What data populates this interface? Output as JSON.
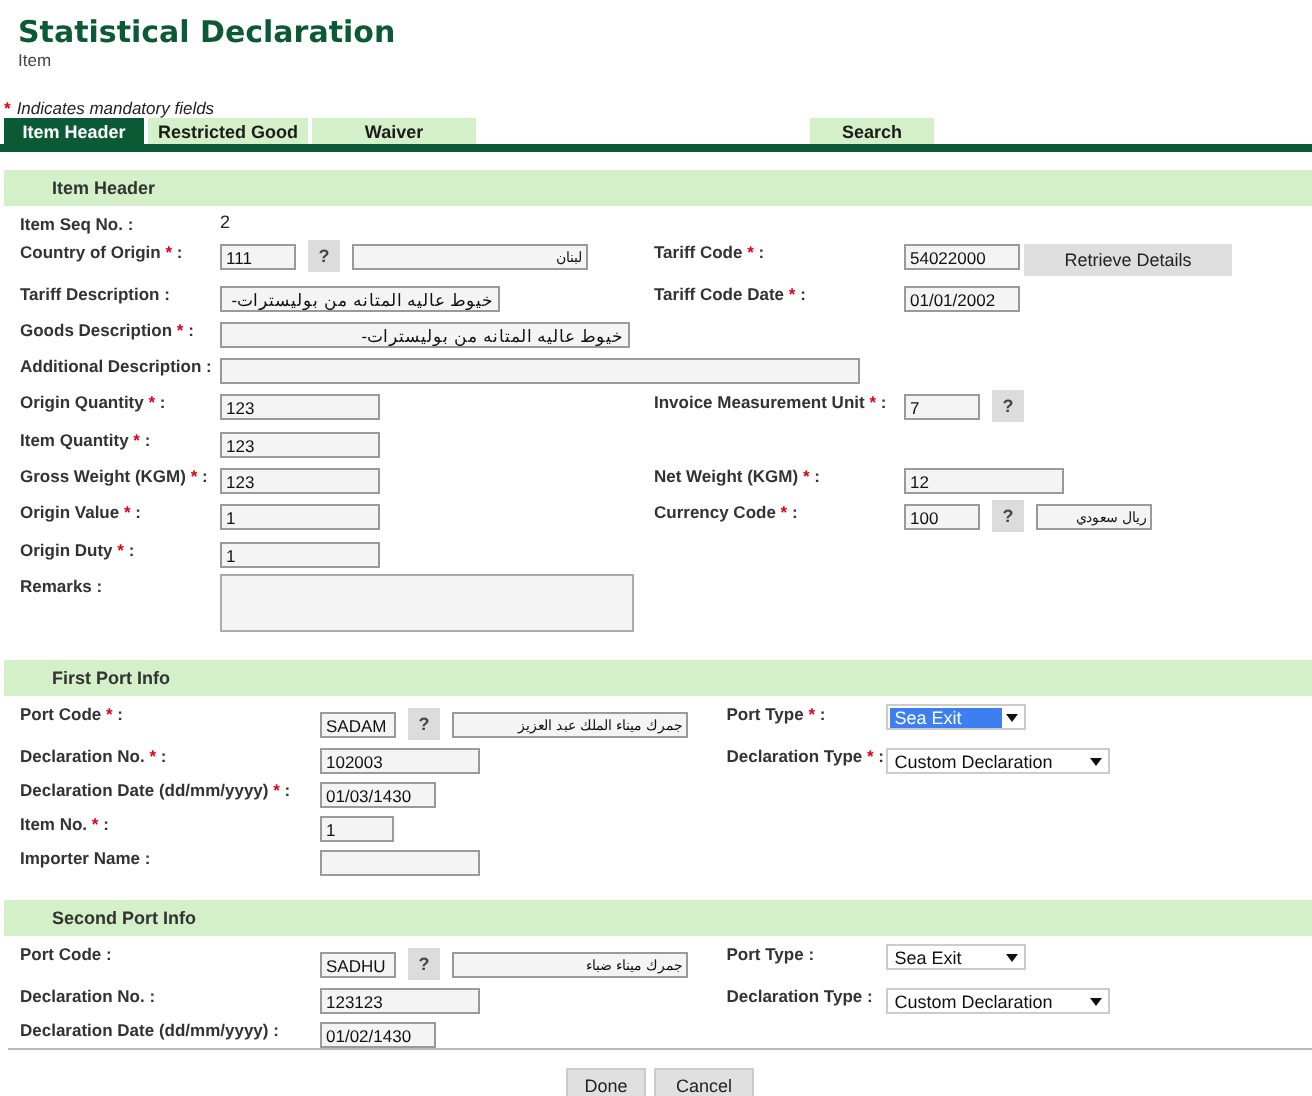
{
  "page": {
    "title": "Statistical Declaration",
    "subtitle": "Item"
  },
  "mandatory_note": {
    "mark": "*",
    "text": "Indicates mandatory fields"
  },
  "tabs": [
    {
      "label": "Item Header",
      "selected": true,
      "kind": "left"
    },
    {
      "label": "Restricted Good",
      "selected": false,
      "kind": "left"
    },
    {
      "label": "Waiver",
      "selected": false,
      "kind": "left"
    },
    {
      "label": "Search",
      "selected": false,
      "kind": "right"
    }
  ],
  "sections": [
    {
      "title": "Item Header",
      "kind": "item",
      "rows": [
        {
          "left": {
            "label": "Item Seq No.",
            "required": false,
            "suffix": ":",
            "controls": [
              {
                "kind": "value",
                "value": "2"
              }
            ]
          }
        },
        {
          "left": {
            "label": "Country of Origin",
            "required": true,
            "suffix": ":",
            "controls": [
              {
                "kind": "code",
                "value": "111"
              },
              {
                "kind": "lookup",
                "label": "?"
              },
              {
                "kind": "name",
                "value": "لبنان"
              }
            ]
          },
          "right": {
            "label": "Tariff Code",
            "required": true,
            "suffix": ":",
            "controls": [
              {
                "kind": "short",
                "value": "54022000"
              },
              {
                "kind": "button",
                "label": "Retrieve Details"
              }
            ]
          }
        },
        {
          "left": {
            "label": "Tariff Description",
            "required": false,
            "suffix": ":",
            "controls": [
              {
                "kind": "long",
                "value": "خيوط عاليه المتانه من بوليسترات-"
              }
            ]
          },
          "right": {
            "label": "Tariff Code Date",
            "required": true,
            "suffix": ":",
            "controls": [
              {
                "kind": "short",
                "value": "01/01/2002"
              }
            ]
          }
        },
        {
          "left": {
            "label": "Goods Description",
            "required": true,
            "suffix": ":",
            "controls": [
              {
                "kind": "longer",
                "value": "خيوط عاليه المتانه من بوليسترات-"
              }
            ]
          }
        },
        {
          "left": {
            "label": "Additional Description",
            "required": false,
            "suffix": ":",
            "controls": [
              {
                "kind": "wide"
              }
            ]
          }
        },
        {
          "left": {
            "label": "Origin Quantity",
            "required": true,
            "suffix": ":",
            "controls": [
              {
                "kind": "medium",
                "value": "123"
              }
            ]
          },
          "right": {
            "label": "Invoice Measurement Unit",
            "required": true,
            "suffix": ":",
            "controls": [
              {
                "kind": "code",
                "value": "7"
              },
              {
                "kind": "lookup",
                "label": "?"
              }
            ]
          }
        },
        {
          "left": {
            "label": "Item Quantity",
            "required": true,
            "suffix": ":",
            "controls": [
              {
                "kind": "medium",
                "value": "123"
              }
            ]
          }
        },
        {
          "left": {
            "label": "Gross Weight (KGM)",
            "required": true,
            "suffix": ":",
            "controls": [
              {
                "kind": "medium",
                "value": "123"
              }
            ]
          },
          "right": {
            "label": "Net Weight (KGM)",
            "required": true,
            "suffix": ":",
            "controls": [
              {
                "kind": "medium",
                "value": "12"
              }
            ]
          }
        },
        {
          "left": {
            "label": "Origin Value",
            "required": true,
            "suffix": ":",
            "controls": [
              {
                "kind": "medium",
                "value": "1"
              }
            ]
          },
          "right": {
            "label": "Currency Code",
            "required": true,
            "suffix": ":",
            "controls": [
              {
                "kind": "code",
                "value": "100"
              },
              {
                "kind": "lookup",
                "label": "?"
              },
              {
                "kind": "small",
                "value": "ريال سعودي"
              }
            ]
          }
        },
        {
          "left": {
            "label": "Origin Duty",
            "required": true,
            "suffix": ":",
            "controls": [
              {
                "kind": "medium",
                "value": "1"
              }
            ]
          }
        },
        {
          "left": {
            "label": "Remarks",
            "required": false,
            "suffix": ":",
            "controls": [
              {
                "kind": "textarea"
              }
            ]
          }
        }
      ]
    },
    {
      "title": "First Port Info",
      "kind": "port",
      "rows": [
        {
          "left": {
            "label": "Port Code",
            "required": true,
            "suffix": ":",
            "controls": [
              {
                "kind": "code",
                "value": "SADAM"
              },
              {
                "kind": "lookup",
                "label": "?"
              },
              {
                "kind": "name",
                "value": "جمرك ميناء الملك عبد العزيز"
              }
            ]
          },
          "right": {
            "label": "Port Type",
            "required": true,
            "suffix": ":",
            "controls": [
              {
                "kind": "select",
                "value": "Sea Exit",
                "highlighted": true
              }
            ]
          }
        },
        {
          "left": {
            "label": "Declaration No.",
            "required": true,
            "suffix": ":",
            "controls": [
              {
                "kind": "medium",
                "value": "102003"
              }
            ]
          },
          "right": {
            "label": "Declaration Type",
            "required": true,
            "suffix": ":",
            "controls": [
              {
                "kind": "wideselect",
                "value": "Custom Declaration",
                "highlighted": false
              }
            ]
          }
        },
        {
          "left": {
            "label": "Declaration Date (dd/mm/yyyy)",
            "required": true,
            "suffix": ":",
            "controls": [
              {
                "kind": "short",
                "value": "01/03/1430"
              }
            ]
          }
        },
        {
          "left": {
            "label": "Item No.",
            "required": true,
            "suffix": ":",
            "controls": [
              {
                "kind": "tiny",
                "value": "1"
              }
            ]
          }
        },
        {
          "left": {
            "label": "Importer Name",
            "required": false,
            "suffix": ":",
            "controls": [
              {
                "kind": "medium"
              }
            ]
          }
        }
      ]
    },
    {
      "title": "Second Port Info",
      "kind": "port",
      "rows": [
        {
          "left": {
            "label": "Port Code",
            "required": false,
            "suffix": ":",
            "controls": [
              {
                "kind": "code",
                "value": "SADHU"
              },
              {
                "kind": "lookup",
                "label": "?"
              },
              {
                "kind": "name",
                "value": "جمرك ميناء ضباء"
              }
            ]
          },
          "right": {
            "label": "Port Type",
            "required": false,
            "suffix": ":",
            "controls": [
              {
                "kind": "select",
                "value": "Sea Exit",
                "highlighted": false
              }
            ]
          }
        },
        {
          "left": {
            "label": "Declaration No.",
            "required": false,
            "suffix": ":",
            "controls": [
              {
                "kind": "medium",
                "value": "123123"
              }
            ]
          },
          "right": {
            "label": "Declaration Type",
            "required": false,
            "suffix": ":",
            "controls": [
              {
                "kind": "wideselect",
                "value": "Custom Declaration",
                "highlighted": false
              }
            ]
          }
        },
        {
          "left": {
            "label": "Declaration Date (dd/mm/yyyy)",
            "required": false,
            "suffix": ":",
            "controls": [
              {
                "kind": "short",
                "value": "01/02/1430"
              }
            ]
          }
        }
      ]
    }
  ],
  "buttons": [
    {
      "label": "Done"
    },
    {
      "label": "Cancel"
    }
  ]
}
